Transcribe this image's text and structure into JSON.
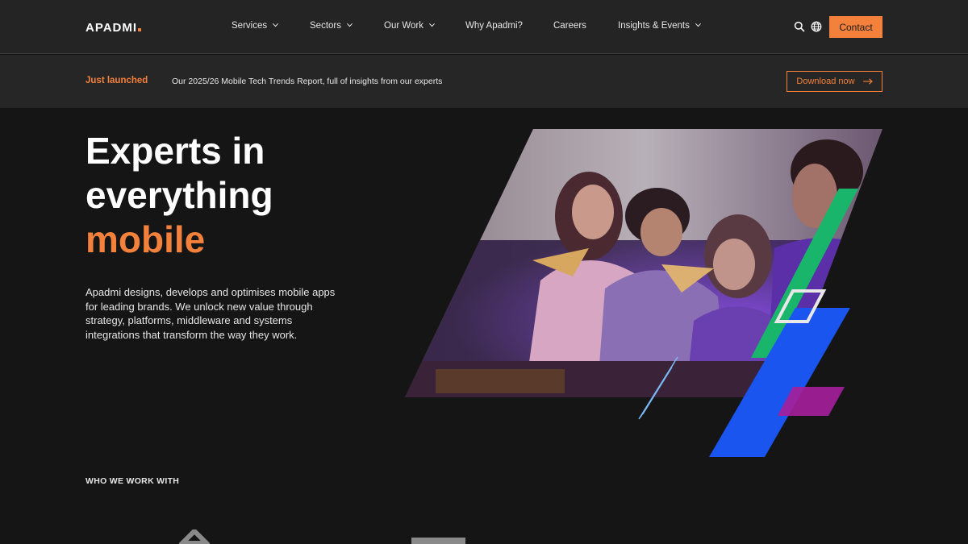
{
  "header": {
    "logo": "APADMI",
    "nav": [
      {
        "label": "Services",
        "dropdown": true
      },
      {
        "label": "Sectors",
        "dropdown": true
      },
      {
        "label": "Our Work",
        "dropdown": true
      },
      {
        "label": "Why Apadmi?",
        "dropdown": false
      },
      {
        "label": "Careers",
        "dropdown": false
      },
      {
        "label": "Insights & Events",
        "dropdown": true
      }
    ],
    "icons": [
      "search-icon",
      "globe-icon"
    ],
    "contact_label": "Contact"
  },
  "banner": {
    "tag": "Just launched",
    "text": "Our 2025/26 Mobile Tech Trends Report, full of insights from our experts",
    "button_label": "Download now"
  },
  "hero": {
    "title_line1": "Experts in",
    "title_line2": "everything",
    "title_accent": "mobile",
    "description": "Apadmi designs, develops and optimises mobile apps for leading brands. We unlock new value through strategy, platforms, middleware and systems integrations that transform the way they work."
  },
  "clients": {
    "heading": "WHO WE WORK WITH"
  },
  "colors": {
    "accent": "#f3813b",
    "background": "#151515",
    "header": "#242424",
    "green": "#19b56a",
    "blue": "#1a55f0",
    "magenta": "#a4209a"
  }
}
